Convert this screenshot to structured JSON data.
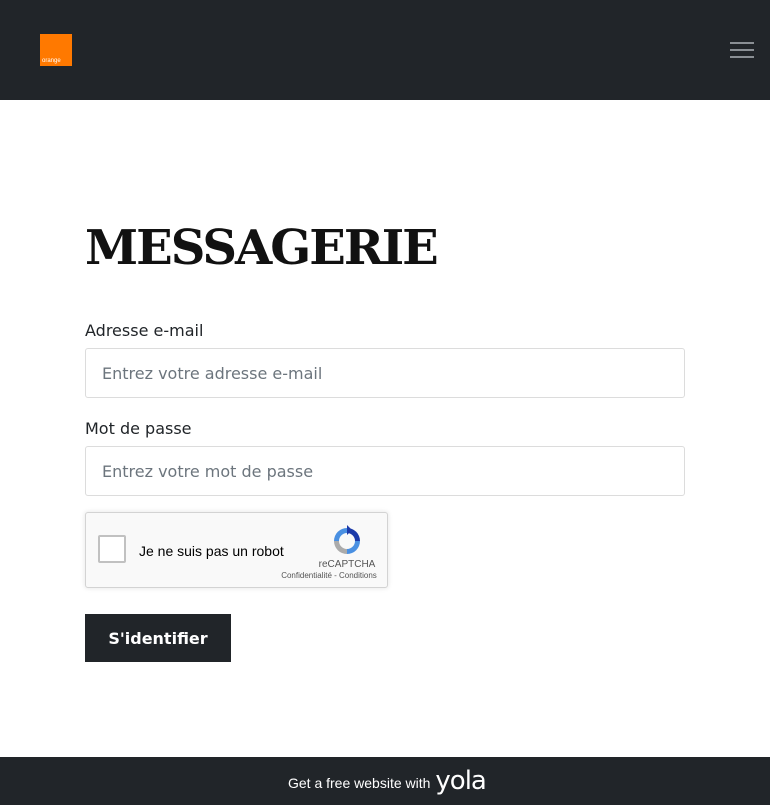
{
  "header": {
    "logo_text": "orange",
    "brand_color": "#ff7900",
    "menu_icon": "hamburger-menu-icon"
  },
  "main": {
    "title": "MESSAGERIE",
    "email": {
      "label": "Adresse e-mail",
      "placeholder": "Entrez votre adresse e-mail",
      "value": ""
    },
    "password": {
      "label": "Mot de passe",
      "placeholder": "Entrez votre mot de passe",
      "value": ""
    },
    "captcha": {
      "label": "Je ne suis pas un robot",
      "brand": "reCAPTCHA",
      "links": "Confidentialité - Conditions",
      "icon": "recaptcha-logo-icon",
      "checked": false
    },
    "submit_label": "S'identifier"
  },
  "footer": {
    "text": "Get a free website with",
    "brand": "yola"
  },
  "colors": {
    "dark": "#212529",
    "accent": "#ff7900"
  }
}
